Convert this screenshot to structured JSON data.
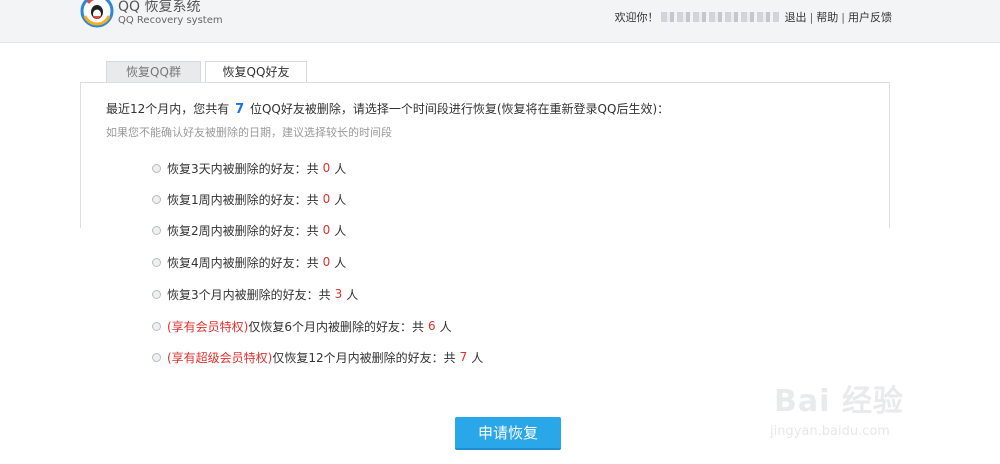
{
  "header": {
    "title": "QQ 恢复系统",
    "subtitle": "QQ Recovery system",
    "welcome": "欢迎你！",
    "logout": "退出",
    "help": "帮助",
    "feedback": "用户反馈",
    "divider": "|"
  },
  "tabs": [
    {
      "label": "恢复QQ群",
      "active": false
    },
    {
      "label": "恢复QQ好友",
      "active": true
    }
  ],
  "intro": {
    "prefix": "最近12个月内，您共有",
    "count": "7",
    "suffix": "位QQ好友被删除，请选择一个时间段进行恢复(恢复将在重新登录QQ后生效)："
  },
  "hint": "如果您不能确认好友被删除的日期，建议选择较长的时间段",
  "options": [
    {
      "priv": "",
      "text": "恢复3天内被删除的好友：共",
      "count": "0",
      "unit": "人"
    },
    {
      "priv": "",
      "text": "恢复1周内被删除的好友：共",
      "count": "0",
      "unit": "人"
    },
    {
      "priv": "",
      "text": "恢复2周内被删除的好友：共",
      "count": "0",
      "unit": "人"
    },
    {
      "priv": "",
      "text": "恢复4周内被删除的好友：共",
      "count": "0",
      "unit": "人"
    },
    {
      "priv": "",
      "text": "恢复3个月内被删除的好友：共",
      "count": "3",
      "unit": "人"
    },
    {
      "priv": "(享有会员特权)",
      "text": "仅恢复6个月内被删除的好友：共",
      "count": "6",
      "unit": "人"
    },
    {
      "priv": "(享有超级会员特权)",
      "text": "仅恢复12个月内被删除的好友：共",
      "count": "7",
      "unit": "人"
    }
  ],
  "submit_label": "申请恢复",
  "watermark": {
    "text": "Bai 经验",
    "url": "jingyan.baidu.com"
  },
  "colors": {
    "accent": "#29a7e8",
    "count": "#1a73e8",
    "highlight": "#e0312e"
  }
}
